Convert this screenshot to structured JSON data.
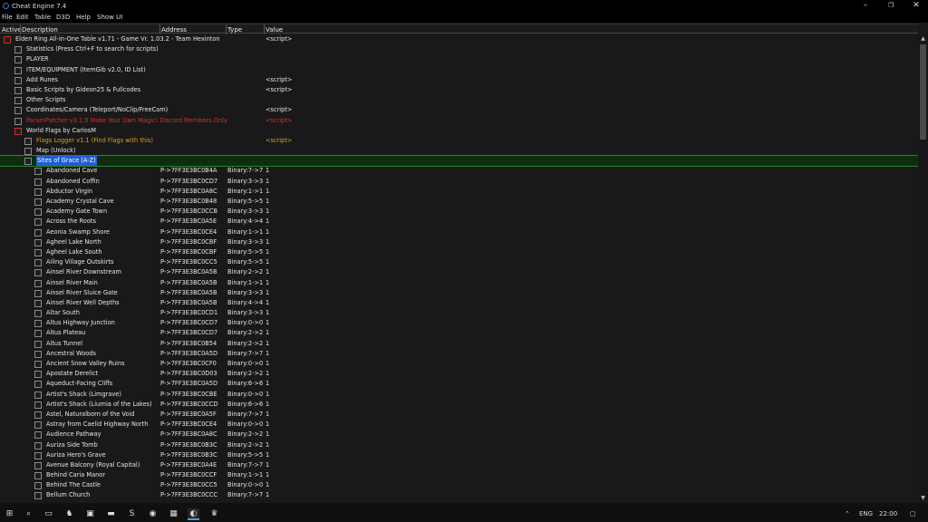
{
  "window": {
    "title": "Cheat Engine 7.4"
  },
  "menu": [
    "File",
    "Edit",
    "Table",
    "D3D",
    "Help",
    "Show UI"
  ],
  "columns": {
    "active": "Active",
    "description": "Description",
    "address": "Address",
    "type": "Type",
    "value": "Value"
  },
  "rows": [
    {
      "desc": "Elden Ring All-in-One Table v1.71 - Game Vr. 1.03.2 - Team Hexinton",
      "val": "<script>",
      "level": 0,
      "style": "normal",
      "cb": "red"
    },
    {
      "desc": "Statistics (Press Ctrl+F to search for scripts)",
      "level": 1
    },
    {
      "desc": "PLAYER",
      "level": 1
    },
    {
      "desc": "ITEM/EQUIPMENT (ItemGib v2.0, ID List)",
      "level": 1
    },
    {
      "desc": "Add Runes",
      "val": "<script>",
      "level": 1
    },
    {
      "desc": "Basic Scripts by Gideon25 & Fullcodes",
      "val": "<script>",
      "level": 1
    },
    {
      "desc": "Other Scripts",
      "level": 1
    },
    {
      "desc": "Coordinates/Camera (Teleport/NoClip/FreeCam)",
      "val": "<script>",
      "level": 1
    },
    {
      "desc": "ParamPatcher v3.1.0 Make Your Own Magic! Discord Members Only",
      "val": "<script>",
      "level": 1,
      "style": "red"
    },
    {
      "desc": "World Flags by CarlosM",
      "level": 1,
      "cb": "red"
    },
    {
      "desc": "Flags Logger v1.1 (Find Flags with this)",
      "val": "<script>",
      "level": 2,
      "style": "orange"
    },
    {
      "desc": "Map (Unlock)",
      "level": 2
    },
    {
      "desc": "Sites of Grace (A-Z)",
      "level": 2,
      "style": "selected"
    },
    {
      "desc": "Abandoned Cave",
      "addr": "P->7FF3E3BC0B4A",
      "type": "Binary:7->7",
      "val": "1",
      "level": 3
    },
    {
      "desc": "Abandoned Coffin",
      "addr": "P->7FF3E3BC0CD7",
      "type": "Binary:3->3",
      "val": "1",
      "level": 3
    },
    {
      "desc": "Abductor Virgin",
      "addr": "P->7FF3E3BC0A8C",
      "type": "Binary:1->1",
      "val": "1",
      "level": 3
    },
    {
      "desc": "Academy Crystal Cave",
      "addr": "P->7FF3E3BC0B48",
      "type": "Binary:5->5",
      "val": "1",
      "level": 3
    },
    {
      "desc": "Academy Gate Town",
      "addr": "P->7FF3E3BC0CCB",
      "type": "Binary:3->3",
      "val": "1",
      "level": 3
    },
    {
      "desc": "Across the Roots",
      "addr": "P->7FF3E3BC0A5E",
      "type": "Binary:4->4",
      "val": "1",
      "level": 3
    },
    {
      "desc": "Aeonia Swamp Shore",
      "addr": "P->7FF3E3BC0CE4",
      "type": "Binary:1->1",
      "val": "1",
      "level": 3
    },
    {
      "desc": "Agheel Lake North",
      "addr": "P->7FF3E3BC0CBF",
      "type": "Binary:3->3",
      "val": "1",
      "level": 3
    },
    {
      "desc": "Agheel Lake South",
      "addr": "P->7FF3E3BC0CBF",
      "type": "Binary:5->5",
      "val": "1",
      "level": 3
    },
    {
      "desc": "Ailing Village Outskirts",
      "addr": "P->7FF3E3BC0CC5",
      "type": "Binary:5->5",
      "val": "1",
      "level": 3
    },
    {
      "desc": "Ainsel River Downstream",
      "addr": "P->7FF3E3BC0A5B",
      "type": "Binary:2->2",
      "val": "1",
      "level": 3
    },
    {
      "desc": "Ainsel River Main",
      "addr": "P->7FF3E3BC0A5B",
      "type": "Binary:1->1",
      "val": "1",
      "level": 3
    },
    {
      "desc": "Ainsel River Sluice Gate",
      "addr": "P->7FF3E3BC0A5B",
      "type": "Binary:3->3",
      "val": "1",
      "level": 3
    },
    {
      "desc": "Ainsel River Well Depths",
      "addr": "P->7FF3E3BC0A5B",
      "type": "Binary:4->4",
      "val": "1",
      "level": 3
    },
    {
      "desc": "Altar South",
      "addr": "P->7FF3E3BC0CD1",
      "type": "Binary:3->3",
      "val": "1",
      "level": 3
    },
    {
      "desc": "Altus Highway Junction",
      "addr": "P->7FF3E3BC0CD7",
      "type": "Binary:0->0",
      "val": "1",
      "level": 3
    },
    {
      "desc": "Altus Plateau",
      "addr": "P->7FF3E3BC0CD7",
      "type": "Binary:2->2",
      "val": "1",
      "level": 3
    },
    {
      "desc": "Altus Tunnel",
      "addr": "P->7FF3E3BC0B54",
      "type": "Binary:2->2",
      "val": "1",
      "level": 3
    },
    {
      "desc": "Ancestral Woods",
      "addr": "P->7FF3E3BC0A5D",
      "type": "Binary:7->7",
      "val": "1",
      "level": 3
    },
    {
      "desc": "Ancient Snow Valley Ruins",
      "addr": "P->7FF3E3BC0CF0",
      "type": "Binary:0->0",
      "val": "1",
      "level": 3
    },
    {
      "desc": "Apostate Derelict",
      "addr": "P->7FF3E3BC0D03",
      "type": "Binary:2->2",
      "val": "1",
      "level": 3
    },
    {
      "desc": "Aqueduct-Facing Cliffs",
      "addr": "P->7FF3E3BC0A5D",
      "type": "Binary:6->6",
      "val": "1",
      "level": 3
    },
    {
      "desc": "Artist's Shack (Limgrave)",
      "addr": "P->7FF3E3BC0CBE",
      "type": "Binary:0->0",
      "val": "1",
      "level": 3
    },
    {
      "desc": "Artist's Shack (Liurnia of the Lakes)",
      "addr": "P->7FF3E3BC0CCD",
      "type": "Binary:6->6",
      "val": "1",
      "level": 3
    },
    {
      "desc": "Astel, Naturalborn of the Void",
      "addr": "P->7FF3E3BC0A5F",
      "type": "Binary:7->7",
      "val": "1",
      "level": 3
    },
    {
      "desc": "Astray from Caelid Highway North",
      "addr": "P->7FF3E3BC0CE4",
      "type": "Binary:0->0",
      "val": "1",
      "level": 3
    },
    {
      "desc": "Audience Pathway",
      "addr": "P->7FF3E3BC0A8C",
      "type": "Binary:2->2",
      "val": "1",
      "level": 3
    },
    {
      "desc": "Auriza Side Tomb",
      "addr": "P->7FF3E3BC0B3C",
      "type": "Binary:2->2",
      "val": "1",
      "level": 3
    },
    {
      "desc": "Auriza Hero's Grave",
      "addr": "P->7FF3E3BC0B3C",
      "type": "Binary:5->5",
      "val": "1",
      "level": 3
    },
    {
      "desc": "Avenue Balcony (Royal Capital)",
      "addr": "P->7FF3E3BC0A4E",
      "type": "Binary:7->7",
      "val": "1",
      "level": 3
    },
    {
      "desc": "Behind Caria Manor",
      "addr": "P->7FF3E3BC0CCF",
      "type": "Binary:1->1",
      "val": "1",
      "level": 3
    },
    {
      "desc": "Behind The Castle",
      "addr": "P->7FF3E3BC0CC5",
      "type": "Binary:0->0",
      "val": "1",
      "level": 3
    },
    {
      "desc": "Bellum Church",
      "addr": "P->7FF3E3BC0CCC",
      "type": "Binary:7->7",
      "val": "1",
      "level": 3
    }
  ],
  "taskbar": {
    "lang": "ENG",
    "time": "22:00"
  }
}
